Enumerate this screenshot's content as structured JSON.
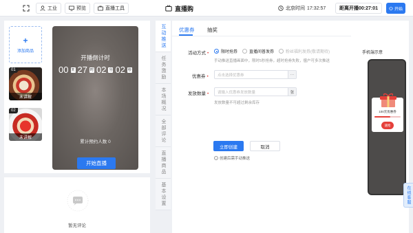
{
  "topbar": {
    "workbench_label": "工业",
    "preview_label": "预览",
    "tools_label": "直播工具",
    "title": "直播购",
    "clock_label": "北京时间",
    "clock_time": "17:32:57",
    "countdown_label": "距离开播",
    "countdown_time": "00:27:01",
    "start_label": "开始"
  },
  "products": {
    "add_label": "添加商品",
    "items": [
      {
        "num": "01",
        "status": "未讲解"
      },
      {
        "num": "02",
        "status": "未讲解"
      }
    ]
  },
  "preview": {
    "title": "开播倒计时",
    "countdown": {
      "d": "00",
      "d_unit": "天",
      "h": "27",
      "h_unit": "时",
      "m": "02",
      "m_unit": "分",
      "s": "02",
      "s_unit": "秒"
    },
    "reserve_label": "累计预约人数",
    "reserve_count": "0",
    "start_button": "开始直播"
  },
  "comments": {
    "empty_text": "暂无评论"
  },
  "vtabs": [
    {
      "label": "互动推送",
      "active": true
    },
    {
      "label": "任务激励",
      "active": false
    },
    {
      "label": "本场概况",
      "active": false
    },
    {
      "label": "全部评论",
      "active": false
    },
    {
      "label": "直播商品",
      "active": false
    },
    {
      "label": "基本设置",
      "active": false
    }
  ],
  "form": {
    "tab_coupon": "优惠券",
    "tab_lottery": "抽奖",
    "activity_label": "活动方式",
    "radio_limited": "限时抢券",
    "radio_live": "直播间普发券",
    "radio_bonus": "粉丝福利发券(敬请期待)",
    "hint_activity": "手动推送直播画面中，限时5秒抢券，超时抢券失败，僵户可多次推送",
    "coupon_label": "优惠券",
    "coupon_placeholder": "点击选择优惠券",
    "qty_label": "发放数量",
    "qty_placeholder": "请输入优惠券发放数量",
    "qty_unit": "张",
    "qty_hint": "发放数量不可超过剩余库存",
    "create_button": "立即创建",
    "cancel_button": "取消",
    "warn_text": "创建后需手动推送"
  },
  "phone": {
    "label": "手机端示意",
    "coupon_title": "100元优惠券",
    "grab_button": "速抢"
  },
  "service": {
    "label": "在线客服"
  }
}
